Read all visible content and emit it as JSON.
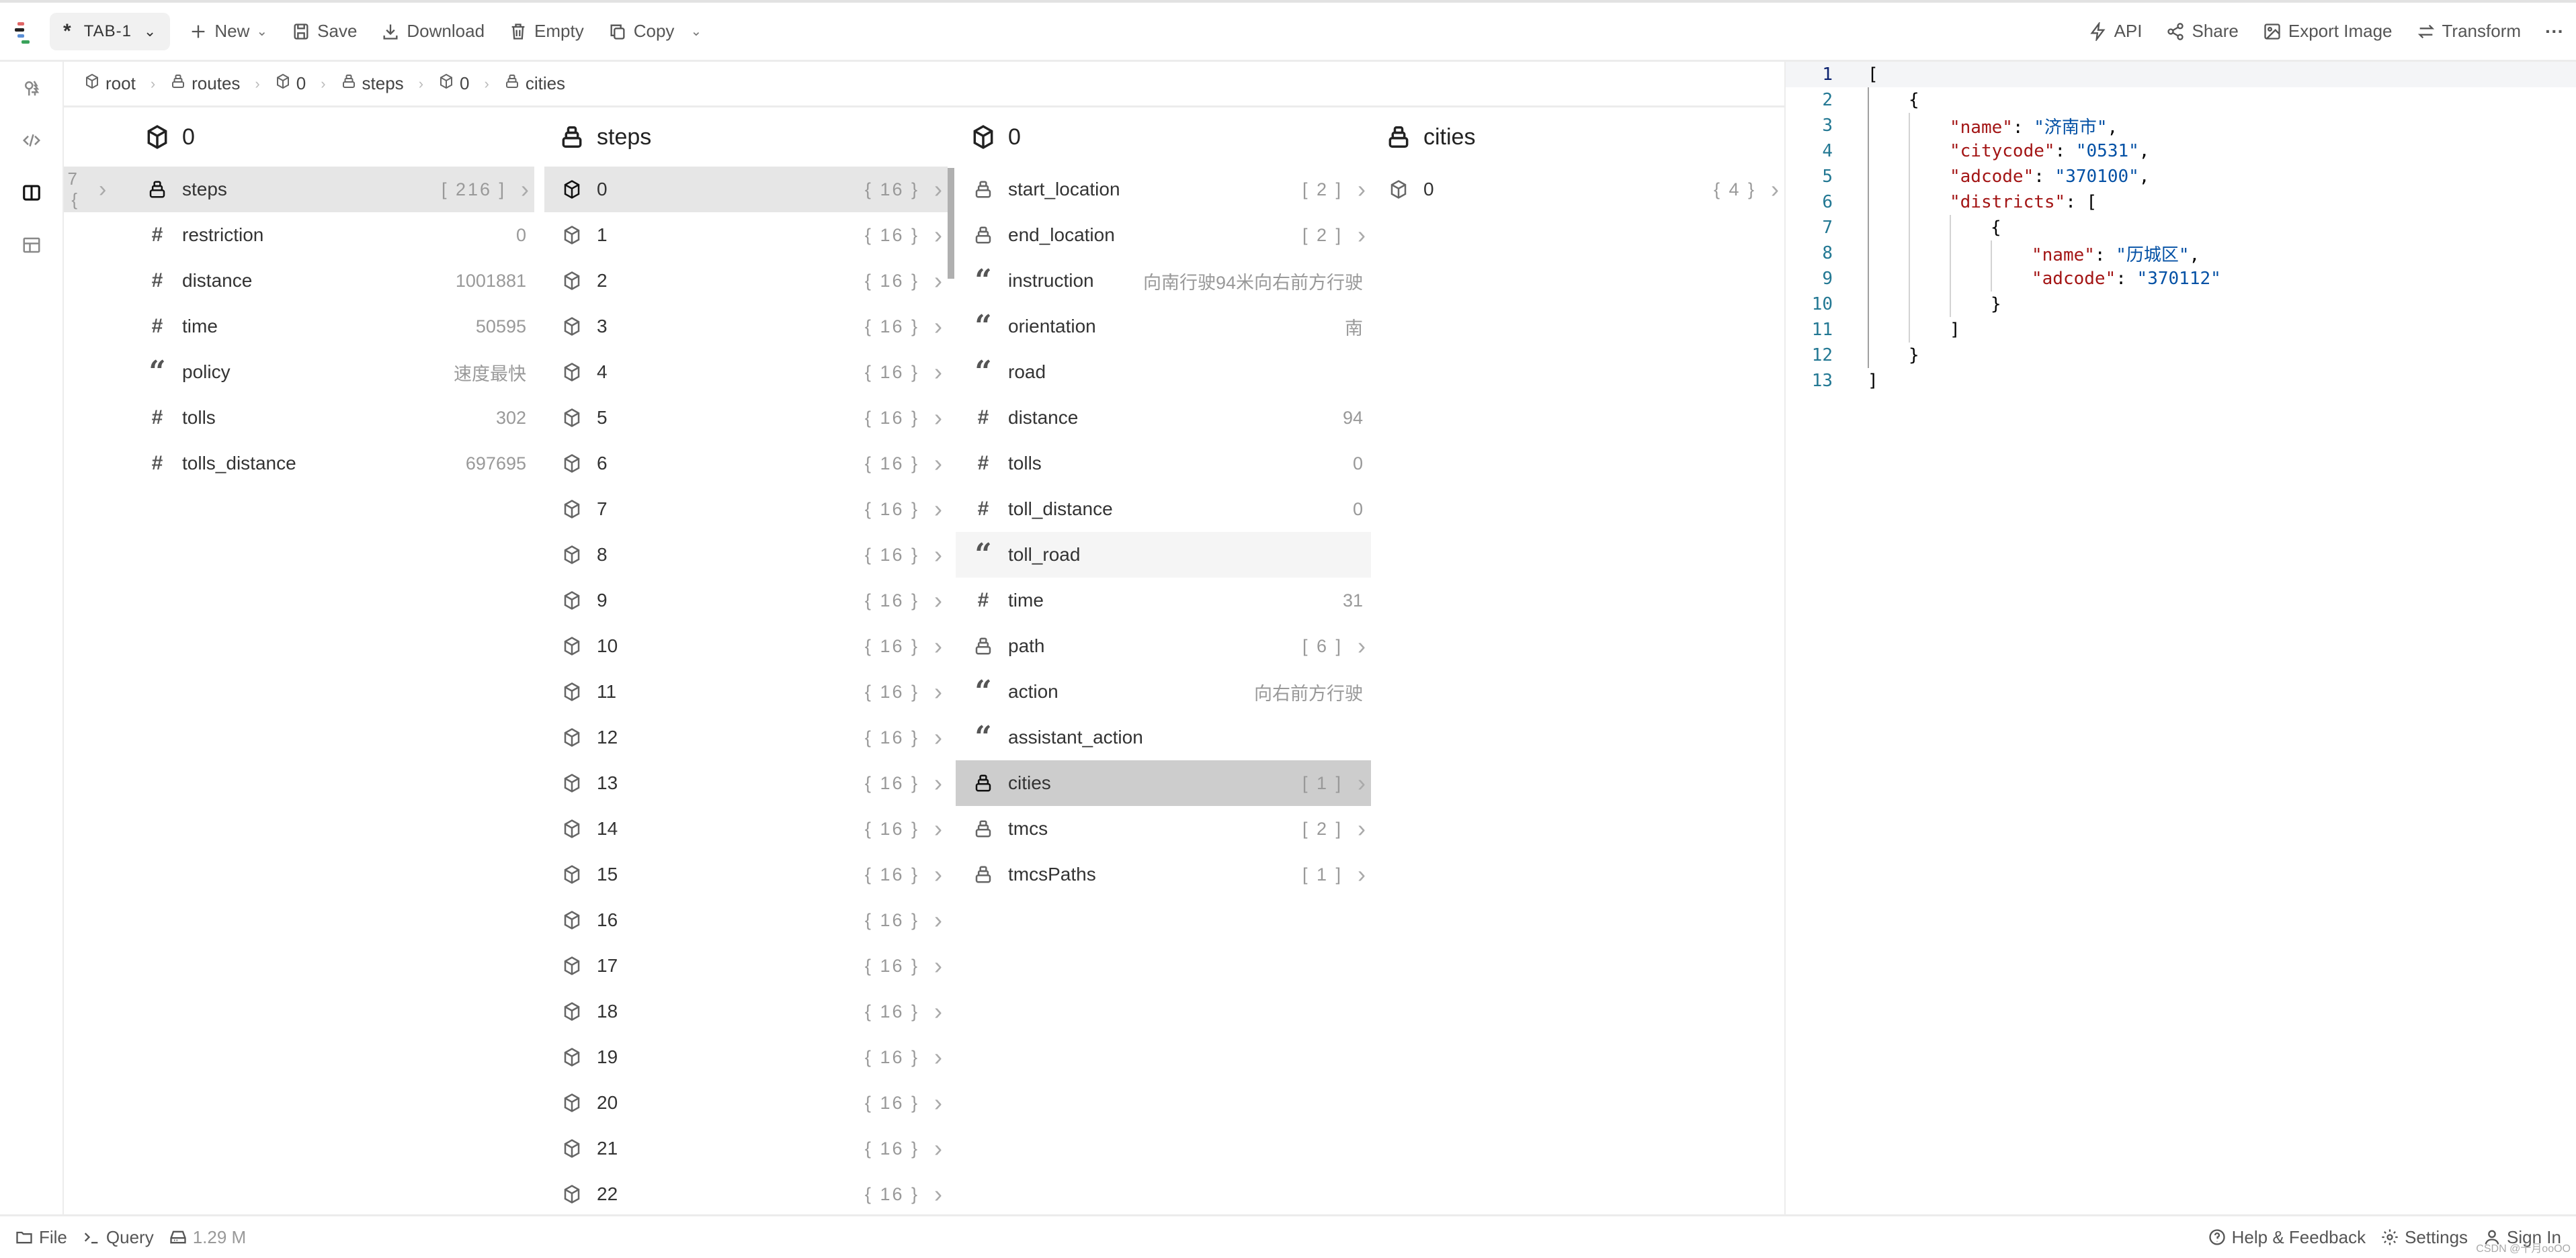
{
  "toolbar": {
    "tab_label": "TAB-1",
    "tab_marker": "*",
    "new_label": "New",
    "save_label": "Save",
    "download_label": "Download",
    "empty_label": "Empty",
    "copy_label": "Copy",
    "api_label": "API",
    "share_label": "Share",
    "export_image_label": "Export Image",
    "transform_label": "Transform",
    "more_label": "···"
  },
  "sidebar": {
    "items": [
      {
        "name": "tree-view",
        "icon": "tree-icon"
      },
      {
        "name": "code-view",
        "icon": "code-icon"
      },
      {
        "name": "column-view",
        "icon": "columns-icon",
        "active": true
      },
      {
        "name": "table-view",
        "icon": "table-icon"
      }
    ]
  },
  "breadcrumb": [
    {
      "label": "root",
      "type": "object"
    },
    {
      "label": "routes",
      "type": "array"
    },
    {
      "label": "0",
      "type": "object"
    },
    {
      "label": "steps",
      "type": "array"
    },
    {
      "label": "0",
      "type": "object"
    },
    {
      "label": "cities",
      "type": "array"
    }
  ],
  "columns": [
    {
      "title": "0",
      "type": "object",
      "partial_prev": "7 }",
      "rows": [
        {
          "key": "steps",
          "type": "array",
          "count": "[ 216 ]",
          "selected": true
        },
        {
          "key": "restriction",
          "type": "number",
          "value": "0"
        },
        {
          "key": "distance",
          "type": "number",
          "value": "1001881"
        },
        {
          "key": "time",
          "type": "number",
          "value": "50595"
        },
        {
          "key": "policy",
          "type": "string",
          "value": "速度最快"
        },
        {
          "key": "tolls",
          "type": "number",
          "value": "302"
        },
        {
          "key": "tolls_distance",
          "type": "number",
          "value": "697695"
        }
      ]
    },
    {
      "title": "steps",
      "type": "array",
      "rows": [
        {
          "key": "0",
          "type": "object",
          "count": "{ 16 }",
          "selected": true
        },
        {
          "key": "1",
          "type": "object",
          "count": "{ 16 }"
        },
        {
          "key": "2",
          "type": "object",
          "count": "{ 16 }"
        },
        {
          "key": "3",
          "type": "object",
          "count": "{ 16 }"
        },
        {
          "key": "4",
          "type": "object",
          "count": "{ 16 }"
        },
        {
          "key": "5",
          "type": "object",
          "count": "{ 16 }"
        },
        {
          "key": "6",
          "type": "object",
          "count": "{ 16 }"
        },
        {
          "key": "7",
          "type": "object",
          "count": "{ 16 }"
        },
        {
          "key": "8",
          "type": "object",
          "count": "{ 16 }"
        },
        {
          "key": "9",
          "type": "object",
          "count": "{ 16 }"
        },
        {
          "key": "10",
          "type": "object",
          "count": "{ 16 }"
        },
        {
          "key": "11",
          "type": "object",
          "count": "{ 16 }"
        },
        {
          "key": "12",
          "type": "object",
          "count": "{ 16 }"
        },
        {
          "key": "13",
          "type": "object",
          "count": "{ 16 }"
        },
        {
          "key": "14",
          "type": "object",
          "count": "{ 16 }"
        },
        {
          "key": "15",
          "type": "object",
          "count": "{ 16 }"
        },
        {
          "key": "16",
          "type": "object",
          "count": "{ 16 }"
        },
        {
          "key": "17",
          "type": "object",
          "count": "{ 16 }"
        },
        {
          "key": "18",
          "type": "object",
          "count": "{ 16 }"
        },
        {
          "key": "19",
          "type": "object",
          "count": "{ 16 }"
        },
        {
          "key": "20",
          "type": "object",
          "count": "{ 16 }"
        },
        {
          "key": "21",
          "type": "object",
          "count": "{ 16 }"
        },
        {
          "key": "22",
          "type": "object",
          "count": "{ 16 }"
        }
      ]
    },
    {
      "title": "0",
      "type": "object",
      "rows": [
        {
          "key": "start_location",
          "type": "array",
          "count": "[ 2 ]"
        },
        {
          "key": "end_location",
          "type": "array",
          "count": "[ 2 ]"
        },
        {
          "key": "instruction",
          "type": "string",
          "value": "向南行驶94米向右前方行驶"
        },
        {
          "key": "orientation",
          "type": "string",
          "value": "南"
        },
        {
          "key": "road",
          "type": "string",
          "value": ""
        },
        {
          "key": "distance",
          "type": "number",
          "value": "94"
        },
        {
          "key": "tolls",
          "type": "number",
          "value": "0"
        },
        {
          "key": "toll_distance",
          "type": "number",
          "value": "0"
        },
        {
          "key": "toll_road",
          "type": "string",
          "value": "",
          "hover": true
        },
        {
          "key": "time",
          "type": "number",
          "value": "31"
        },
        {
          "key": "path",
          "type": "array",
          "count": "[ 6 ]"
        },
        {
          "key": "action",
          "type": "string",
          "value": "向右前方行驶"
        },
        {
          "key": "assistant_action",
          "type": "string",
          "value": ""
        },
        {
          "key": "cities",
          "type": "array",
          "count": "[ 1 ]",
          "selected": true
        },
        {
          "key": "tmcs",
          "type": "array",
          "count": "[ 2 ]"
        },
        {
          "key": "tmcsPaths",
          "type": "array",
          "count": "[ 1 ]"
        }
      ]
    },
    {
      "title": "cities",
      "type": "array",
      "rows": [
        {
          "key": "0",
          "type": "object",
          "count": "{ 4 }"
        }
      ]
    }
  ],
  "editor": {
    "lines": [
      {
        "n": "1",
        "indent": 0,
        "parts": [
          [
            "p",
            "["
          ]
        ]
      },
      {
        "n": "2",
        "indent": 1,
        "parts": [
          [
            "p",
            "{"
          ]
        ]
      },
      {
        "n": "3",
        "indent": 2,
        "parts": [
          [
            "k",
            "\"name\""
          ],
          [
            "p",
            ": "
          ],
          [
            "s",
            "\"济南市\""
          ],
          [
            "p",
            ","
          ]
        ]
      },
      {
        "n": "4",
        "indent": 2,
        "parts": [
          [
            "k",
            "\"citycode\""
          ],
          [
            "p",
            ": "
          ],
          [
            "s",
            "\"0531\""
          ],
          [
            "p",
            ","
          ]
        ]
      },
      {
        "n": "5",
        "indent": 2,
        "parts": [
          [
            "k",
            "\"adcode\""
          ],
          [
            "p",
            ": "
          ],
          [
            "s",
            "\"370100\""
          ],
          [
            "p",
            ","
          ]
        ]
      },
      {
        "n": "6",
        "indent": 2,
        "parts": [
          [
            "k",
            "\"districts\""
          ],
          [
            "p",
            ": ["
          ]
        ]
      },
      {
        "n": "7",
        "indent": 3,
        "parts": [
          [
            "p",
            "{"
          ]
        ]
      },
      {
        "n": "8",
        "indent": 4,
        "parts": [
          [
            "k",
            "\"name\""
          ],
          [
            "p",
            ": "
          ],
          [
            "s",
            "\"历城区\""
          ],
          [
            "p",
            ","
          ]
        ]
      },
      {
        "n": "9",
        "indent": 4,
        "parts": [
          [
            "k",
            "\"adcode\""
          ],
          [
            "p",
            ": "
          ],
          [
            "s",
            "\"370112\""
          ]
        ]
      },
      {
        "n": "10",
        "indent": 3,
        "parts": [
          [
            "p",
            "}"
          ]
        ]
      },
      {
        "n": "11",
        "indent": 2,
        "parts": [
          [
            "p",
            "]"
          ]
        ]
      },
      {
        "n": "12",
        "indent": 1,
        "parts": [
          [
            "p",
            "}"
          ]
        ]
      },
      {
        "n": "13",
        "indent": 0,
        "parts": [
          [
            "p",
            "]"
          ]
        ]
      }
    ]
  },
  "footer": {
    "file_label": "File",
    "query_label": "Query",
    "size_label": "1.29 M",
    "help_label": "Help & Feedback",
    "settings_label": "Settings",
    "signin_label": "Sign In",
    "watermark": "CSDN @十月ooOO"
  },
  "colors": {
    "selected_row": "#e6e6e6",
    "active_row": "#cdcdcd",
    "json_key": "#a31515",
    "json_string": "#0451a5",
    "line_number": "#237893"
  }
}
